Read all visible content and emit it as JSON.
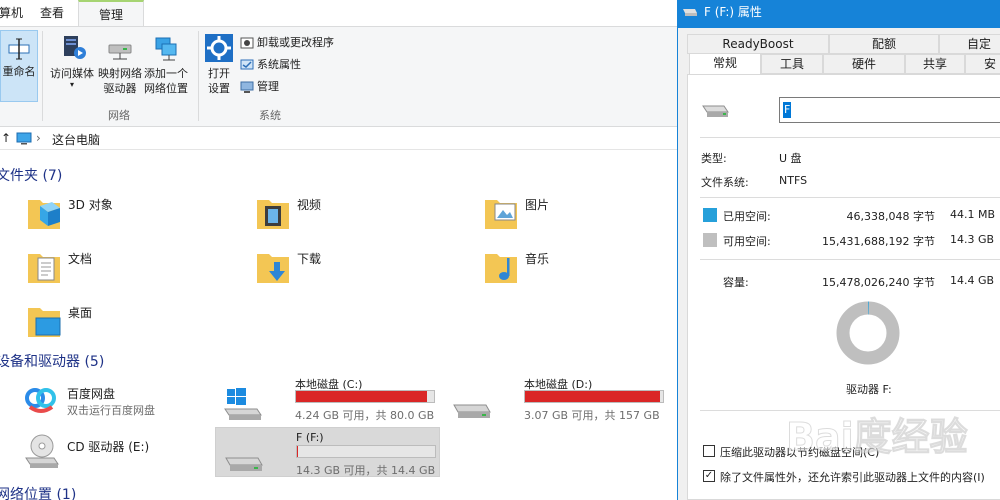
{
  "explorer": {
    "ribbon_tabs": [
      "算机",
      "查看",
      "管理"
    ],
    "ribbon": {
      "rename": "重命名",
      "access_media": "访问媒体",
      "map_drive_line1": "映射网络",
      "map_drive_line2": "驱动器",
      "add_location_line1": "添加一个",
      "add_location_line2": "网络位置",
      "open_settings_line1": "打开",
      "open_settings_line2": "设置",
      "uninstall": "卸载或更改程序",
      "system_props": "系统属性",
      "manage": "管理",
      "group_network": "网络",
      "group_system": "系统"
    },
    "address": {
      "location": "这台电脑"
    },
    "folders_header": "文件夹 (7)",
    "folders": [
      "3D 对象",
      "视频",
      "图片",
      "文档",
      "下载",
      "音乐",
      "桌面"
    ],
    "devices_header": "设备和驱动器 (5)",
    "baidu": {
      "name": "百度网盘",
      "sub": "双击运行百度网盘"
    },
    "drives": [
      {
        "name": "本地磁盘 (C:)",
        "sub": "4.24 GB 可用，共 80.0 GB",
        "used_fraction": 0.947
      },
      {
        "name": "本地磁盘 (D:)",
        "sub": "3.07 GB 可用，共 157 GB",
        "used_fraction": 0.98
      },
      {
        "name": "F (F:)",
        "sub": "14.3 GB 可用，共 14.4 GB",
        "used_fraction": 0.003
      }
    ],
    "cd_drive": "CD 驱动器 (E:)",
    "network_header": "网络位置 (1)"
  },
  "dialog": {
    "title": "F (F:) 属性",
    "tabs_row1": [
      "ReadyBoost",
      "配额",
      "自定"
    ],
    "tabs_row2": [
      "常规",
      "工具",
      "硬件",
      "共享",
      "安"
    ],
    "name_value": "F",
    "type_label": "类型:",
    "type_value": "U 盘",
    "fs_label": "文件系统:",
    "fs_value": "NTFS",
    "used_label": "已用空间:",
    "used_bytes": "46,338,048 字节",
    "used_size": "44.1 MB",
    "free_label": "可用空间:",
    "free_bytes": "15,431,688,192 字节",
    "free_size": "14.3 GB",
    "cap_label": "容量:",
    "cap_bytes": "15,478,026,240 字节",
    "cap_size": "14.4 GB",
    "drive_label": "驱动器 F:",
    "compress_label": "压缩此驱动器以节约磁盘空间(C)",
    "index_label": "除了文件属性外，还允许索引此驱动器上文件的内容(I)",
    "used_color": "#26a0da",
    "free_color": "#bfbfbf"
  },
  "watermark": "Bai度经验"
}
